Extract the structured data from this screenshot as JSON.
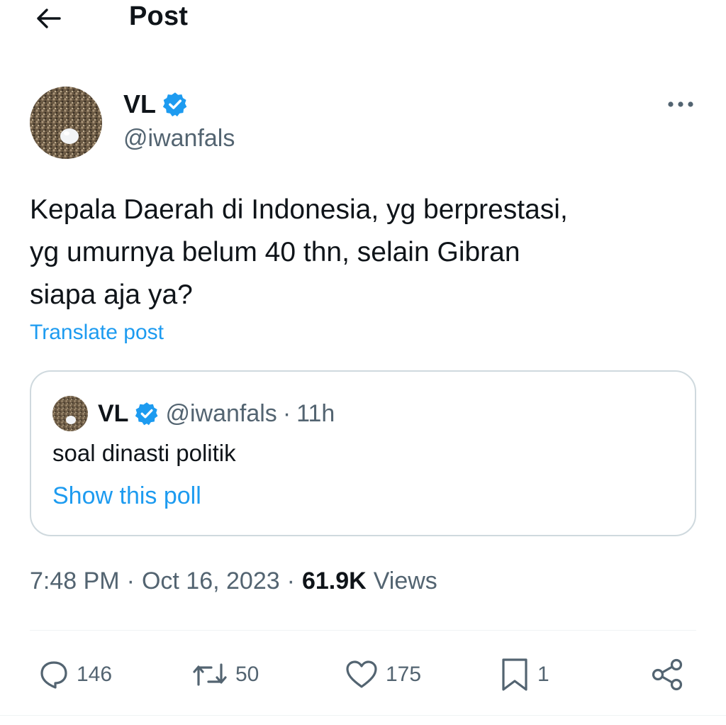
{
  "header": {
    "title": "Post",
    "back_icon": "arrow-left-icon"
  },
  "author": {
    "name": "VL",
    "handle": "@iwanfals",
    "verified": true,
    "avatar_icon": "avatar-image"
  },
  "post": {
    "text_lines": [
      "Kepala Daerah di Indonesia, yg berprestasi,",
      "yg umurnya belum 40 thn, selain Gibran",
      "siapa aja ya?"
    ],
    "translate_label": "Translate post"
  },
  "quote": {
    "name": "VL",
    "handle": "@iwanfals",
    "time_sep": "·",
    "time": "11h",
    "text": "soal dinasti politik",
    "show_poll_label": "Show this poll"
  },
  "meta": {
    "time": "7:48 PM",
    "sep1": "·",
    "date": "Oct 16, 2023",
    "sep2": "·",
    "views_count": "61.9K",
    "views_label": "Views"
  },
  "actions": {
    "replies": "146",
    "reposts": "50",
    "likes": "175",
    "bookmarks": "1"
  },
  "colors": {
    "accent": "#1d9bf0",
    "text_primary": "#0f1419",
    "text_secondary": "#536471",
    "border": "#cfd9de"
  }
}
